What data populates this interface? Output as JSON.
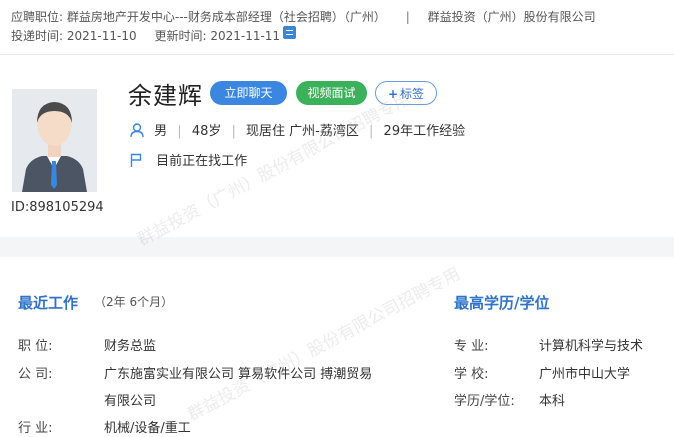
{
  "header": {
    "applied_position_label": "应聘职位:",
    "applied_position": "群益房地产开发中心---财务成本部经理（社会招聘）（广州）",
    "separator": "|",
    "company": "群益投资（广州）股份有限公司",
    "submitted_label": "投递时间:",
    "submitted_date": "2021-11-10",
    "updated_label": "更新时间:",
    "updated_date": "2021-11-11",
    "update_icon": "refresh-icon"
  },
  "candidate": {
    "name": "余建辉",
    "id_label": "ID:898105294",
    "gender": "男",
    "age": "48岁",
    "residence": "现居住 广州-荔湾区",
    "experience": "29年工作经验",
    "job_status": "目前正在找工作"
  },
  "actions": {
    "chat": "立即聊天",
    "video": "视频面试",
    "tag_plus": "+",
    "tag": "标签"
  },
  "work": {
    "title": "最近工作",
    "duration": "（2年 6个月）",
    "rows": [
      {
        "label": "职    位:",
        "value": "财务总监"
      },
      {
        "label": "公    司:",
        "value": "广东施富实业有限公司 算易软件公司 搏潮贸易"
      },
      {
        "label": "",
        "value": "有限公司"
      },
      {
        "label": "行    业:",
        "value": "机械/设备/重工"
      }
    ]
  },
  "education": {
    "title": "最高学历/学位",
    "rows": [
      {
        "label": "专    业:",
        "value": "计算机科学与技术"
      },
      {
        "label": "学    校:",
        "value": "广州市中山大学"
      },
      {
        "label": "学历/学位:",
        "value": "本科"
      }
    ]
  },
  "watermark": "群益投资（广州）股份有限公司招聘专用",
  "colors": {
    "accent": "#2f73c9",
    "chat": "#3a86e0",
    "video": "#3ab15a"
  }
}
